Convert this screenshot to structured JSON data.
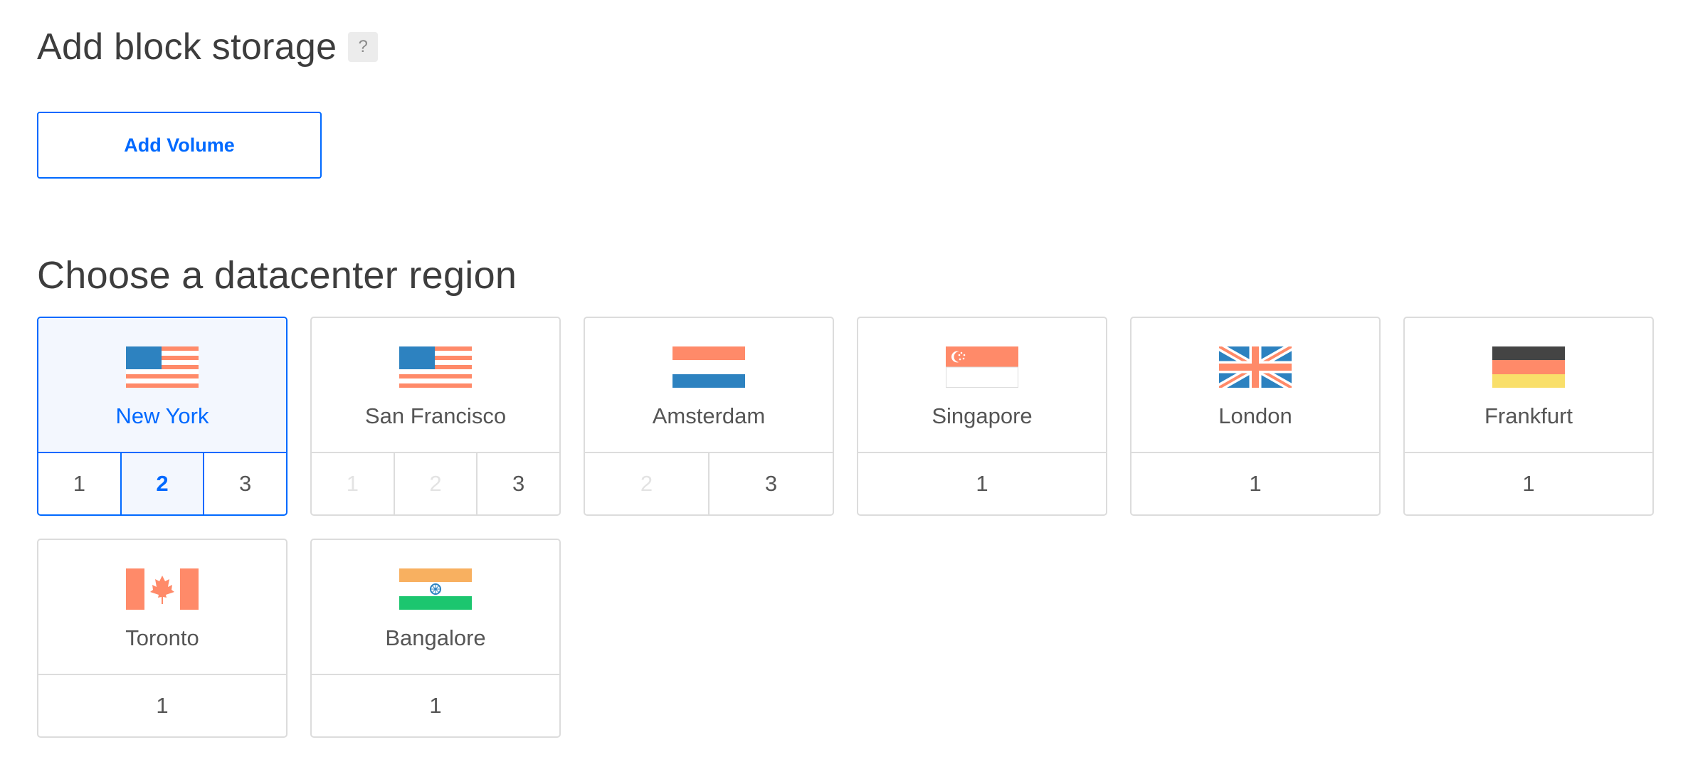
{
  "block_storage": {
    "title": "Add block storage",
    "help_label": "?",
    "add_volume_label": "Add Volume"
  },
  "region_section": {
    "title": "Choose a datacenter region"
  },
  "regions": [
    {
      "name": "New York",
      "flag_icon": "us-flag-icon",
      "selected": true,
      "datacenters": [
        {
          "label": "1",
          "state": "available"
        },
        {
          "label": "2",
          "state": "selected"
        },
        {
          "label": "3",
          "state": "available"
        }
      ]
    },
    {
      "name": "San Francisco",
      "flag_icon": "us-flag-icon",
      "selected": false,
      "datacenters": [
        {
          "label": "1",
          "state": "disabled"
        },
        {
          "label": "2",
          "state": "disabled"
        },
        {
          "label": "3",
          "state": "available"
        }
      ]
    },
    {
      "name": "Amsterdam",
      "flag_icon": "netherlands-flag-icon",
      "selected": false,
      "datacenters": [
        {
          "label": "2",
          "state": "disabled"
        },
        {
          "label": "3",
          "state": "available"
        }
      ]
    },
    {
      "name": "Singapore",
      "flag_icon": "singapore-flag-icon",
      "selected": false,
      "datacenters": [
        {
          "label": "1",
          "state": "available"
        }
      ]
    },
    {
      "name": "London",
      "flag_icon": "uk-flag-icon",
      "selected": false,
      "datacenters": [
        {
          "label": "1",
          "state": "available"
        }
      ]
    },
    {
      "name": "Frankfurt",
      "flag_icon": "germany-flag-icon",
      "selected": false,
      "datacenters": [
        {
          "label": "1",
          "state": "available"
        }
      ]
    },
    {
      "name": "Toronto",
      "flag_icon": "canada-flag-icon",
      "selected": false,
      "datacenters": [
        {
          "label": "1",
          "state": "available"
        }
      ]
    },
    {
      "name": "Bangalore",
      "flag_icon": "india-flag-icon",
      "selected": false,
      "datacenters": [
        {
          "label": "1",
          "state": "available"
        }
      ]
    }
  ],
  "colors": {
    "accent": "#0069ff",
    "selected_bg": "#f3f7fe",
    "border": "#dcdcdc",
    "flag_blue": "#2d82c0",
    "flag_salmon": "#ff8a69",
    "flag_dark": "#444444",
    "flag_yellow": "#f9df6a",
    "flag_saffron": "#f8b060",
    "flag_green": "#1cc66f"
  }
}
